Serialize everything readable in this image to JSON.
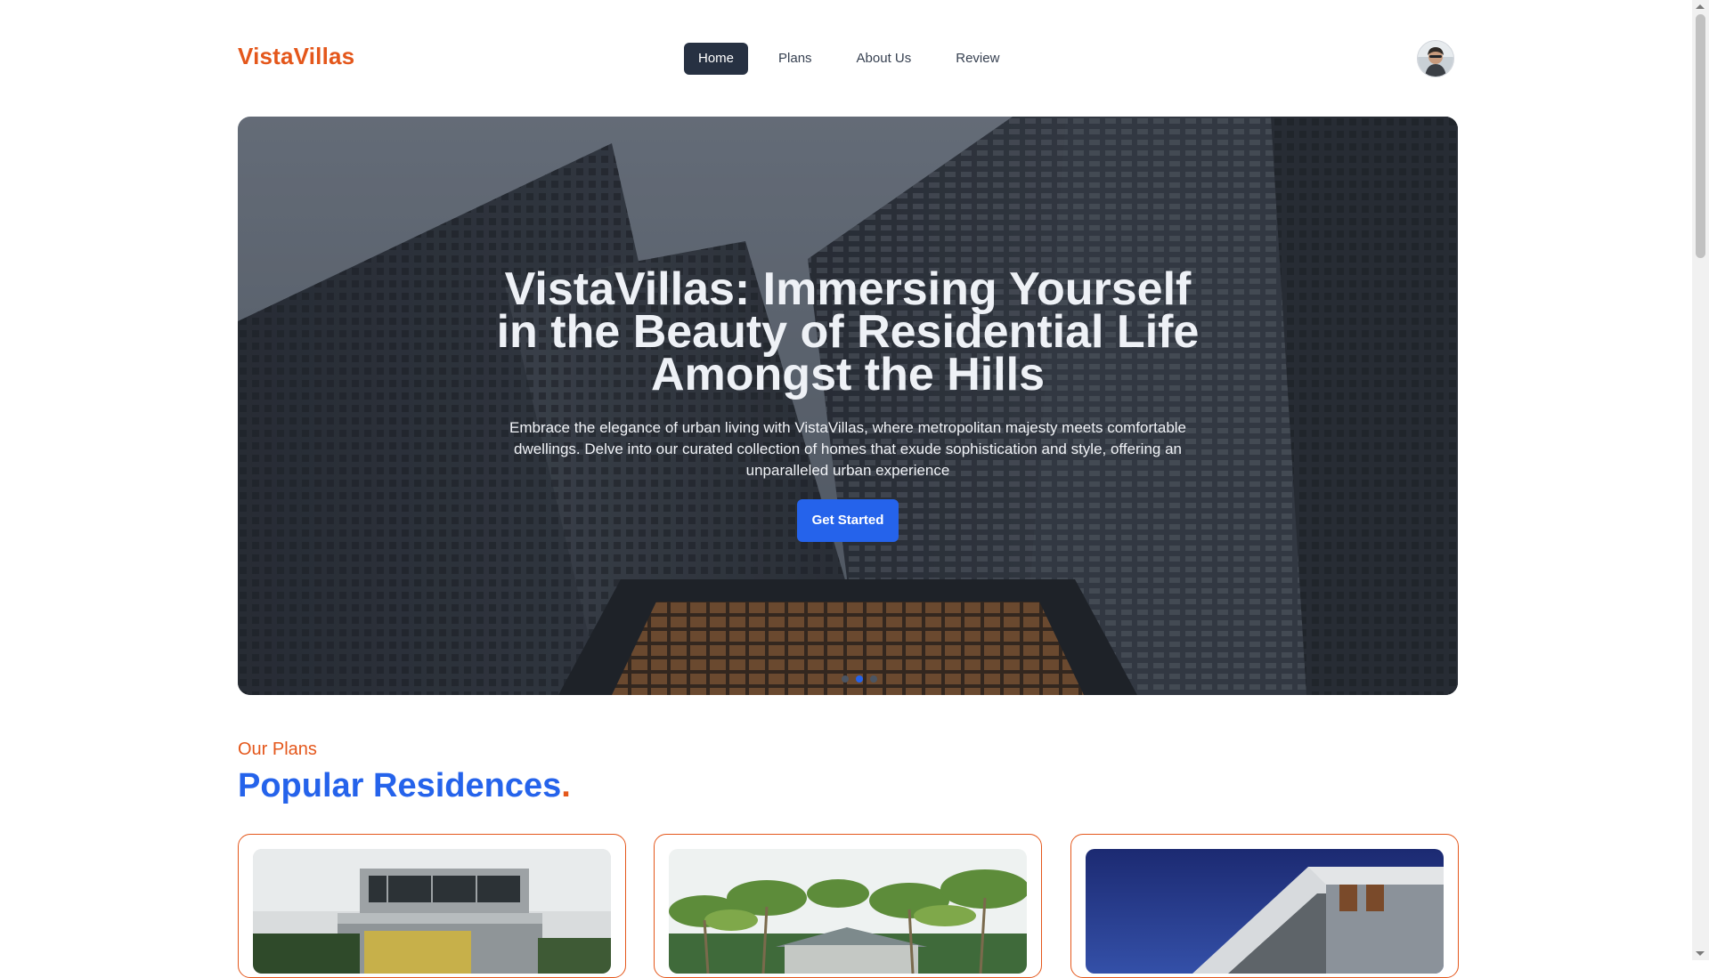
{
  "brand": {
    "name": "VistaVillas"
  },
  "nav": {
    "items": [
      {
        "label": "Home",
        "active": true
      },
      {
        "label": "Plans",
        "active": false
      },
      {
        "label": "About Us",
        "active": false
      },
      {
        "label": "Review",
        "active": false
      }
    ]
  },
  "user": {
    "avatar_icon": "user-avatar"
  },
  "hero": {
    "title": "VistaVillas: Immersing Yourself in the Beauty of Residential Life Amongst the Hills",
    "description": "Embrace the elegance of urban living with VistaVillas, where metropolitan majesty meets comfortable dwellings. Delve into our curated collection of homes that exude sophistication and style, offering an unparalleled urban experience",
    "cta_label": "Get Started",
    "slide_count": 3,
    "active_slide": 2
  },
  "plans": {
    "eyebrow": "Our Plans",
    "title": "Popular Residences",
    "title_suffix": "."
  },
  "colors": {
    "brand_orange": "#e4571b",
    "primary_blue": "#2563eb",
    "nav_active_bg": "#273142"
  }
}
